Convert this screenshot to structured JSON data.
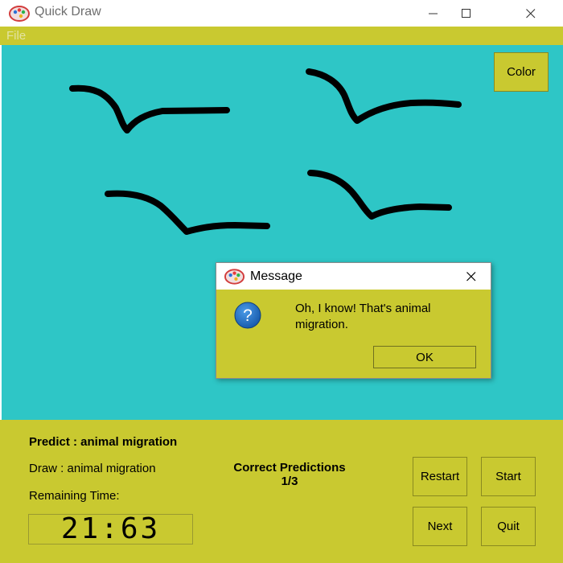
{
  "window": {
    "title": "Quick Draw",
    "icons": {
      "app": "palette-icon",
      "minimize": "minimize-icon",
      "maximize": "maximize-icon",
      "close": "close-icon"
    }
  },
  "menu": {
    "file": "File"
  },
  "canvas": {
    "background": "#2ec6c6",
    "stroke_color": "#000000",
    "color_button": "Color"
  },
  "dialog": {
    "title": "Message",
    "message": "Oh, I know! That's animal migration.",
    "ok": "OK",
    "icons": {
      "app": "palette-icon",
      "question": "question-icon",
      "close": "close-icon"
    }
  },
  "panel": {
    "predict": "Predict : animal migration",
    "draw": "Draw : animal migration",
    "remaining": "Remaining Time:",
    "correct_label": "Correct Predictions",
    "correct_value": "1/3",
    "timer": "21:63",
    "buttons": {
      "restart": "Restart",
      "start": "Start",
      "next": "Next",
      "quit": "Quit"
    }
  },
  "colors": {
    "accent": "#c9c930",
    "canvas": "#2ec6c6",
    "question_blue": "#1f6fc6"
  }
}
